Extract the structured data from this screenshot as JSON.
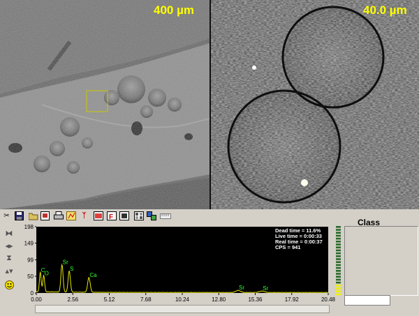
{
  "images": {
    "left_scale": "400 µm",
    "right_scale": "40.0 µm"
  },
  "toolbar": {
    "icons": [
      "scissors-icon",
      "save-icon",
      "open-icon",
      "image-icon",
      "print-icon",
      "chart-icon",
      "marker-icon",
      "spectrum-red-icon",
      "font-red-icon",
      "frame-icon",
      "palette-icon",
      "transfer-icon",
      "ruler-icon"
    ]
  },
  "spectrum": {
    "y_ticks": [
      "198",
      "149",
      "99",
      "50",
      "0"
    ],
    "x_ticks": [
      "0.00",
      "2.56",
      "5.12",
      "7.68",
      "10.24",
      "12.80",
      "15.36",
      "17.92",
      "20.48"
    ],
    "stats": {
      "dead": "Dead time = 11.6%",
      "live": "Live time = 0:00:33",
      "real": "Real time = 0:00:37",
      "cps": "CPS = 941"
    },
    "peaks": [
      {
        "label": "C",
        "x": 0.28,
        "y": 58
      },
      {
        "label": "O",
        "x": 0.52,
        "y": 49
      },
      {
        "label": "Sr",
        "x": 1.8,
        "y": 82
      },
      {
        "label": "S",
        "x": 2.31,
        "y": 63
      },
      {
        "label": "Ca",
        "x": 3.69,
        "y": 44
      },
      {
        "label": "Sr",
        "x": 14.16,
        "y": 6
      },
      {
        "label": "Sr",
        "x": 15.84,
        "y": 4
      }
    ],
    "colors": {
      "trace": "#e8e800",
      "labels": "#33ff33",
      "text": "#ffffff",
      "bg": "#000000"
    }
  },
  "class_panel": {
    "title": "Class"
  }
}
